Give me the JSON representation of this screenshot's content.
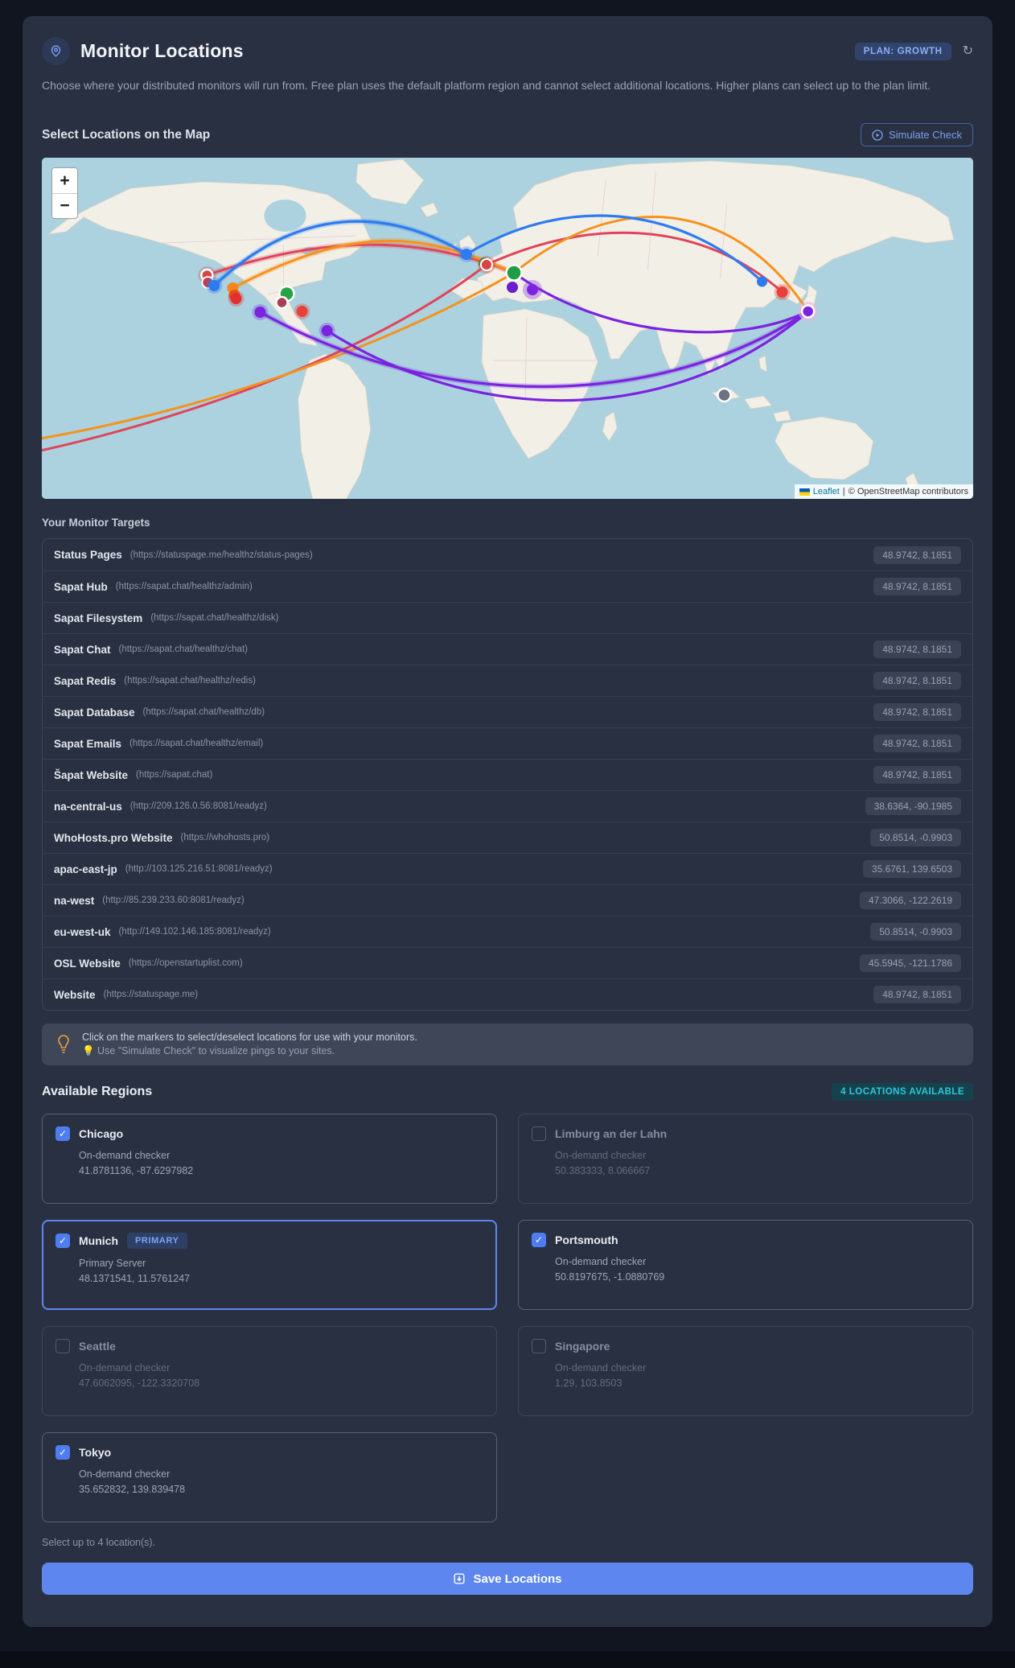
{
  "header": {
    "title": "Monitor Locations",
    "plan_badge": "PLAN: GROWTH",
    "description": "Choose where your distributed monitors will run from. Free plan uses the default platform region and cannot select additional locations. Higher plans can select up to the plan limit."
  },
  "map_section": {
    "heading": "Select Locations on the Map",
    "simulate_button": "Simulate Check",
    "zoom_in": "+",
    "zoom_out": "−",
    "attribution": {
      "leaflet": "Leaflet",
      "separator": "|",
      "osm": "© OpenStreetMap contributors"
    }
  },
  "targets": {
    "heading": "Your Monitor Targets",
    "rows": [
      {
        "name": "Status Pages",
        "url": "(https://statuspage.me/healthz/status-pages)",
        "coords": "48.9742, 8.1851"
      },
      {
        "name": "Sapat Hub",
        "url": "(https://sapat.chat/healthz/admin)",
        "coords": "48.9742, 8.1851"
      },
      {
        "name": "Sapat Filesystem",
        "url": "(https://sapat.chat/healthz/disk)",
        "coords": ""
      },
      {
        "name": "Sapat Chat",
        "url": "(https://sapat.chat/healthz/chat)",
        "coords": "48.9742, 8.1851"
      },
      {
        "name": "Sapat Redis",
        "url": "(https://sapat.chat/healthz/redis)",
        "coords": "48.9742, 8.1851"
      },
      {
        "name": "Sapat Database",
        "url": "(https://sapat.chat/healthz/db)",
        "coords": "48.9742, 8.1851"
      },
      {
        "name": "Sapat Emails",
        "url": "(https://sapat.chat/healthz/email)",
        "coords": "48.9742, 8.1851"
      },
      {
        "name": "Šapat Website",
        "url": "(https://sapat.chat)",
        "coords": "48.9742, 8.1851"
      },
      {
        "name": "na-central-us",
        "url": "(http://209.126.0.56:8081/readyz)",
        "coords": "38.6364, -90.1985"
      },
      {
        "name": "WhoHosts.pro Website",
        "url": "(https://whohosts.pro)",
        "coords": "50.8514, -0.9903"
      },
      {
        "name": "apac-east-jp",
        "url": "(http://103.125.216.51:8081/readyz)",
        "coords": "35.6761, 139.6503"
      },
      {
        "name": "na-west",
        "url": "(http://85.239.233.60:8081/readyz)",
        "coords": "47.3066, -122.2619"
      },
      {
        "name": "eu-west-uk",
        "url": "(http://149.102.146.185:8081/readyz)",
        "coords": "50.8514, -0.9903"
      },
      {
        "name": "OSL Website",
        "url": "(https://openstartuplist.com)",
        "coords": "45.5945, -121.1786"
      },
      {
        "name": "Website",
        "url": "(https://statuspage.me)",
        "coords": "48.9742, 8.1851"
      }
    ]
  },
  "tip": {
    "line1": "Click on the markers to select/deselect locations for use with your monitors.",
    "line2": "💡 Use \"Simulate Check\" to visualize pings to your sites."
  },
  "regions": {
    "heading": "Available Regions",
    "availability_badge": "4 LOCATIONS AVAILABLE",
    "cards": [
      {
        "name": "Chicago",
        "checked": true,
        "disabled": false,
        "primary": false,
        "sub": "On-demand checker",
        "coords": "41.8781136, -87.6297982"
      },
      {
        "name": "Limburg an der Lahn",
        "checked": false,
        "disabled": true,
        "primary": false,
        "sub": "On-demand checker",
        "coords": "50.383333, 8.066667"
      },
      {
        "name": "Munich",
        "checked": true,
        "disabled": false,
        "primary": true,
        "primary_badge": "PRIMARY",
        "sub": "Primary Server",
        "coords": "48.1371541, 11.5761247"
      },
      {
        "name": "Portsmouth",
        "checked": true,
        "disabled": false,
        "primary": false,
        "sub": "On-demand checker",
        "coords": "50.8197675, -1.0880769"
      },
      {
        "name": "Seattle",
        "checked": false,
        "disabled": true,
        "primary": false,
        "sub": "On-demand checker",
        "coords": "47.6062095, -122.3320708"
      },
      {
        "name": "Singapore",
        "checked": false,
        "disabled": true,
        "primary": false,
        "sub": "On-demand checker",
        "coords": "1.29, 103.8503"
      },
      {
        "name": "Tokyo",
        "checked": true,
        "disabled": false,
        "primary": false,
        "sub": "On-demand checker",
        "coords": "35.652832, 139.839478"
      }
    ],
    "footnote": "Select up to 4 location(s).",
    "save_button": "Save Locations"
  },
  "colors": {
    "accent_blue": "#5d87ee",
    "plan_badge_text": "#8aaef7",
    "teal_badge_text": "#2fc6da",
    "arc_blue": "#2e7bf0",
    "arc_orange": "#f5921f",
    "arc_red": "#e0445a",
    "arc_purple": "#7a24e0",
    "map_water": "#abd2de",
    "map_land": "#f2efe7"
  }
}
